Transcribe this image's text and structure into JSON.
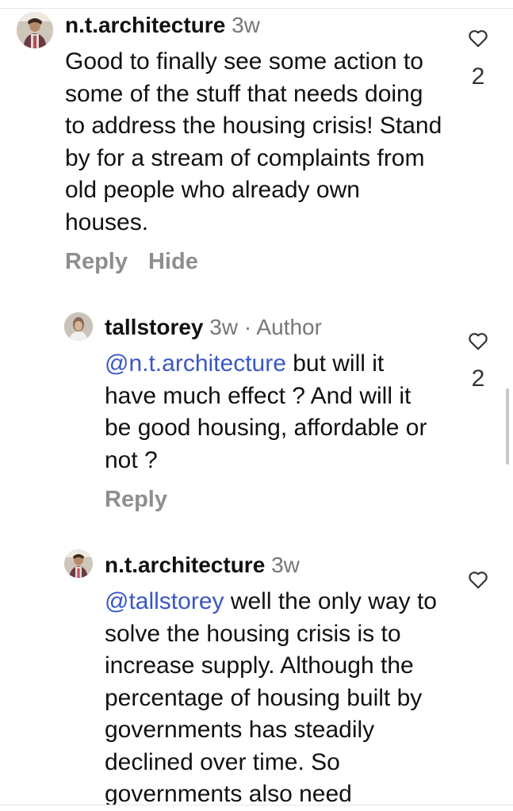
{
  "comments": [
    {
      "username": "n.t.architecture",
      "meta": "3w",
      "body": "Good to finally see some action to some of the stuff that needs doing to address the housing crisis! Stand by for a stream of complaints from old people who already own houses.",
      "actions": [
        "Reply",
        "Hide"
      ],
      "likes": "2"
    },
    {
      "username": "tallstorey",
      "meta": "3w · Author",
      "mention": "@n.t.architecture",
      "body": " but will it have much effect ? And will it be good housing, affordable or not ?",
      "actions": [
        "Reply"
      ],
      "likes": "2"
    },
    {
      "username": "n.t.architecture",
      "meta": "3w",
      "mention": "@tallstorey",
      "body": " well the only way to solve the housing crisis is to increase supply. Although the percentage of housing built by governments has steadily declined over time. So governments also need"
    }
  ]
}
